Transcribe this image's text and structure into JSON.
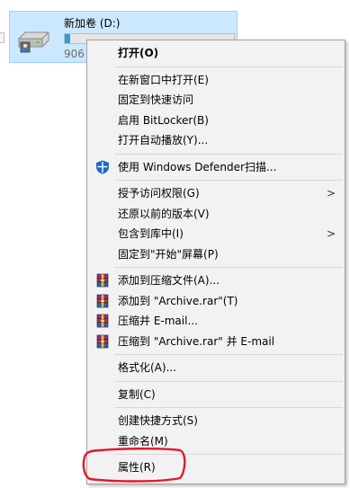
{
  "drive": {
    "name": "新加卷 (D:)",
    "free_space": "906",
    "usage_fraction": 0.03
  },
  "menu": {
    "items": [
      {
        "label": "打开(O)",
        "bold": true
      },
      {
        "label": "在新窗口中打开(E)"
      },
      {
        "label": "固定到快速访问"
      },
      {
        "label": "启用 BitLocker(B)"
      },
      {
        "label": "打开自动播放(Y)..."
      },
      {
        "label": "使用 Windows Defender扫描...",
        "icon": "windows-defender-shield-icon"
      },
      {
        "label": "授予访问权限(G)",
        "has_submenu": true
      },
      {
        "label": "还原以前的版本(V)"
      },
      {
        "label": "包含到库中(I)",
        "has_submenu": true
      },
      {
        "label": "固定到\"开始\"屏幕(P)"
      },
      {
        "label": "添加到压缩文件(A)...",
        "icon": "winrar-icon"
      },
      {
        "label": "添加到 \"Archive.rar\"(T)",
        "icon": "winrar-icon"
      },
      {
        "label": "压缩并 E-mail...",
        "icon": "winrar-icon"
      },
      {
        "label": "压缩到 \"Archive.rar\" 并 E-mail",
        "icon": "winrar-icon"
      },
      {
        "label": "格式化(A)..."
      },
      {
        "label": "复制(C)"
      },
      {
        "label": "创建快捷方式(S)"
      },
      {
        "label": "重命名(M)"
      },
      {
        "label": "属性(R)",
        "highlighted": true
      }
    ],
    "submenu_arrow": ">"
  },
  "colors": {
    "menu_background": "#f2f2f2",
    "drive_selection": "#cce8ff",
    "highlight_stroke": "#e0192a",
    "defender_blue": "#1b6ac9"
  }
}
